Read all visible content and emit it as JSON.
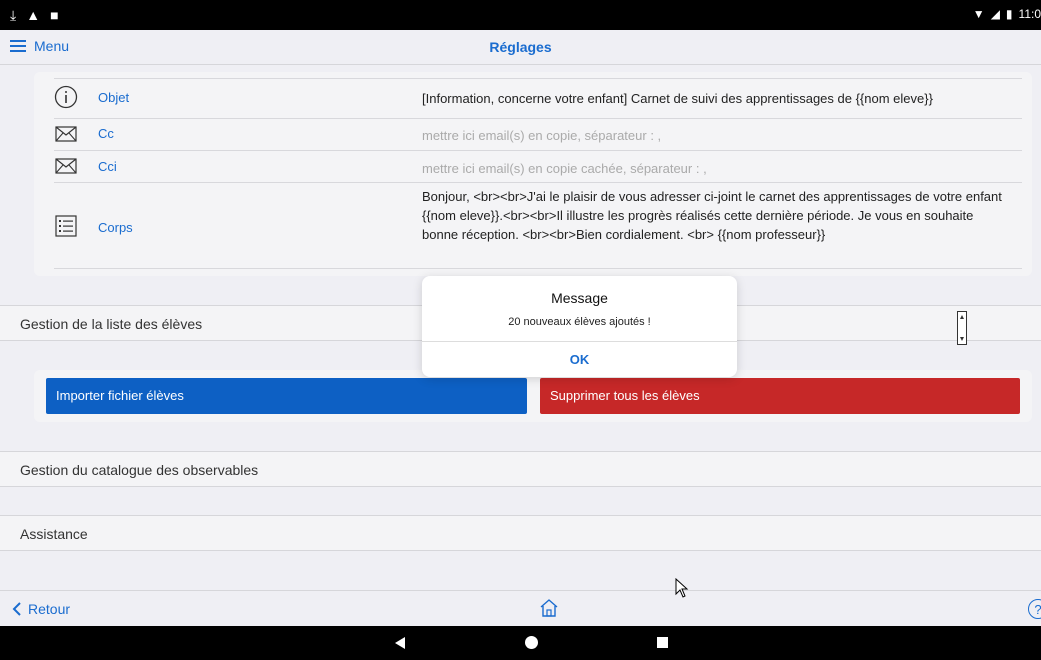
{
  "status_bar": {
    "time": "11:0"
  },
  "nav": {
    "menu_label": "Menu",
    "title": "Réglages"
  },
  "email": {
    "objet_label": "Objet",
    "objet_value": "[Information, concerne votre enfant] Carnet de suivi des apprentissages de {{nom eleve}}",
    "cc_label": "Cc",
    "cc_placeholder": "mettre ici email(s) en copie, séparateur : ,",
    "cci_label": "Cci",
    "cci_placeholder": "mettre ici email(s) en copie cachée, séparateur : ,",
    "corps_label": "Corps",
    "corps_value": "Bonjour, <br><br>J'ai le plaisir de vous adresser ci-joint le carnet des apprentissages de votre enfant {{nom eleve}}.<br><br>Il illustre les progrès réalisés cette dernière période. Je vous en souhaite bonne réception. <br><br>Bien cordialement. <br> {{nom professeur}}"
  },
  "sections": {
    "eleves": "Gestion de la liste des élèves",
    "catalogue": "Gestion du catalogue des observables",
    "assistance": "Assistance"
  },
  "buttons": {
    "import": "Importer fichier élèves",
    "delete": "Supprimer tous les élèves"
  },
  "colors": {
    "accent": "#1a6ccf",
    "import_button": "#0d60c4",
    "delete_button": "#c62828"
  },
  "toolbar": {
    "back_label": "Retour",
    "help": "?"
  },
  "dialog": {
    "title": "Message",
    "message": "20 nouveaux élèves ajoutés !",
    "ok": "OK"
  }
}
